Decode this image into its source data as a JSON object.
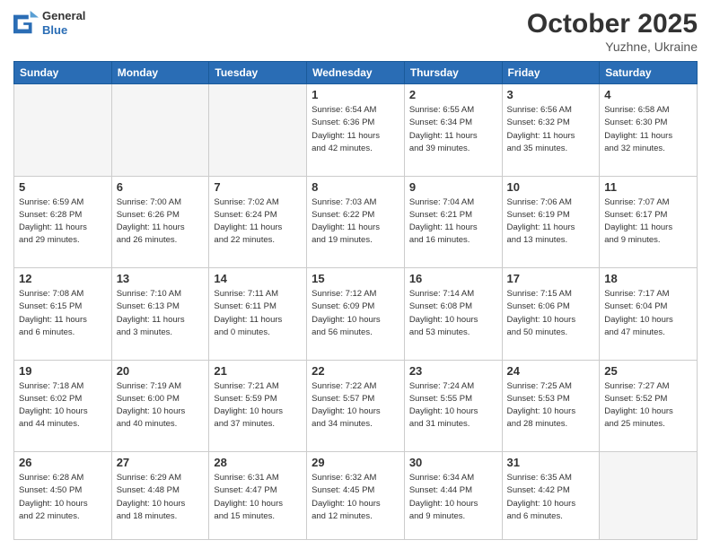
{
  "header": {
    "logo_general": "General",
    "logo_blue": "Blue",
    "month": "October 2025",
    "location": "Yuzhne, Ukraine"
  },
  "days_of_week": [
    "Sunday",
    "Monday",
    "Tuesday",
    "Wednesday",
    "Thursday",
    "Friday",
    "Saturday"
  ],
  "weeks": [
    [
      {
        "day": "",
        "info": ""
      },
      {
        "day": "",
        "info": ""
      },
      {
        "day": "",
        "info": ""
      },
      {
        "day": "1",
        "info": "Sunrise: 6:54 AM\nSunset: 6:36 PM\nDaylight: 11 hours\nand 42 minutes."
      },
      {
        "day": "2",
        "info": "Sunrise: 6:55 AM\nSunset: 6:34 PM\nDaylight: 11 hours\nand 39 minutes."
      },
      {
        "day": "3",
        "info": "Sunrise: 6:56 AM\nSunset: 6:32 PM\nDaylight: 11 hours\nand 35 minutes."
      },
      {
        "day": "4",
        "info": "Sunrise: 6:58 AM\nSunset: 6:30 PM\nDaylight: 11 hours\nand 32 minutes."
      }
    ],
    [
      {
        "day": "5",
        "info": "Sunrise: 6:59 AM\nSunset: 6:28 PM\nDaylight: 11 hours\nand 29 minutes."
      },
      {
        "day": "6",
        "info": "Sunrise: 7:00 AM\nSunset: 6:26 PM\nDaylight: 11 hours\nand 26 minutes."
      },
      {
        "day": "7",
        "info": "Sunrise: 7:02 AM\nSunset: 6:24 PM\nDaylight: 11 hours\nand 22 minutes."
      },
      {
        "day": "8",
        "info": "Sunrise: 7:03 AM\nSunset: 6:22 PM\nDaylight: 11 hours\nand 19 minutes."
      },
      {
        "day": "9",
        "info": "Sunrise: 7:04 AM\nSunset: 6:21 PM\nDaylight: 11 hours\nand 16 minutes."
      },
      {
        "day": "10",
        "info": "Sunrise: 7:06 AM\nSunset: 6:19 PM\nDaylight: 11 hours\nand 13 minutes."
      },
      {
        "day": "11",
        "info": "Sunrise: 7:07 AM\nSunset: 6:17 PM\nDaylight: 11 hours\nand 9 minutes."
      }
    ],
    [
      {
        "day": "12",
        "info": "Sunrise: 7:08 AM\nSunset: 6:15 PM\nDaylight: 11 hours\nand 6 minutes."
      },
      {
        "day": "13",
        "info": "Sunrise: 7:10 AM\nSunset: 6:13 PM\nDaylight: 11 hours\nand 3 minutes."
      },
      {
        "day": "14",
        "info": "Sunrise: 7:11 AM\nSunset: 6:11 PM\nDaylight: 11 hours\nand 0 minutes."
      },
      {
        "day": "15",
        "info": "Sunrise: 7:12 AM\nSunset: 6:09 PM\nDaylight: 10 hours\nand 56 minutes."
      },
      {
        "day": "16",
        "info": "Sunrise: 7:14 AM\nSunset: 6:08 PM\nDaylight: 10 hours\nand 53 minutes."
      },
      {
        "day": "17",
        "info": "Sunrise: 7:15 AM\nSunset: 6:06 PM\nDaylight: 10 hours\nand 50 minutes."
      },
      {
        "day": "18",
        "info": "Sunrise: 7:17 AM\nSunset: 6:04 PM\nDaylight: 10 hours\nand 47 minutes."
      }
    ],
    [
      {
        "day": "19",
        "info": "Sunrise: 7:18 AM\nSunset: 6:02 PM\nDaylight: 10 hours\nand 44 minutes."
      },
      {
        "day": "20",
        "info": "Sunrise: 7:19 AM\nSunset: 6:00 PM\nDaylight: 10 hours\nand 40 minutes."
      },
      {
        "day": "21",
        "info": "Sunrise: 7:21 AM\nSunset: 5:59 PM\nDaylight: 10 hours\nand 37 minutes."
      },
      {
        "day": "22",
        "info": "Sunrise: 7:22 AM\nSunset: 5:57 PM\nDaylight: 10 hours\nand 34 minutes."
      },
      {
        "day": "23",
        "info": "Sunrise: 7:24 AM\nSunset: 5:55 PM\nDaylight: 10 hours\nand 31 minutes."
      },
      {
        "day": "24",
        "info": "Sunrise: 7:25 AM\nSunset: 5:53 PM\nDaylight: 10 hours\nand 28 minutes."
      },
      {
        "day": "25",
        "info": "Sunrise: 7:27 AM\nSunset: 5:52 PM\nDaylight: 10 hours\nand 25 minutes."
      }
    ],
    [
      {
        "day": "26",
        "info": "Sunrise: 6:28 AM\nSunset: 4:50 PM\nDaylight: 10 hours\nand 22 minutes."
      },
      {
        "day": "27",
        "info": "Sunrise: 6:29 AM\nSunset: 4:48 PM\nDaylight: 10 hours\nand 18 minutes."
      },
      {
        "day": "28",
        "info": "Sunrise: 6:31 AM\nSunset: 4:47 PM\nDaylight: 10 hours\nand 15 minutes."
      },
      {
        "day": "29",
        "info": "Sunrise: 6:32 AM\nSunset: 4:45 PM\nDaylight: 10 hours\nand 12 minutes."
      },
      {
        "day": "30",
        "info": "Sunrise: 6:34 AM\nSunset: 4:44 PM\nDaylight: 10 hours\nand 9 minutes."
      },
      {
        "day": "31",
        "info": "Sunrise: 6:35 AM\nSunset: 4:42 PM\nDaylight: 10 hours\nand 6 minutes."
      },
      {
        "day": "",
        "info": ""
      }
    ]
  ]
}
